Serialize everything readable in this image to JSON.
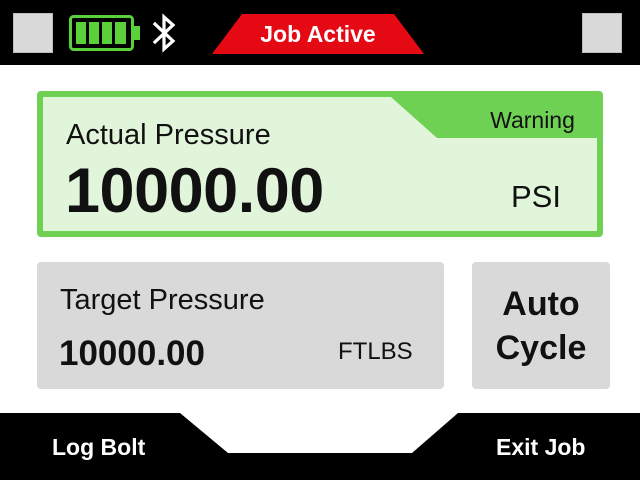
{
  "status_bar": {
    "job_status": "Job Active",
    "battery_icon": "battery-full-icon",
    "bluetooth_icon": "bluetooth-icon",
    "battery_level": 1.0,
    "colors": {
      "bar": "#000000",
      "job_tab": "#e50914",
      "battery": "#5ad13a"
    }
  },
  "actual_pressure": {
    "title": "Actual Pressure",
    "value": "10000.00",
    "unit": "PSI",
    "badge": "Warning",
    "colors": {
      "border": "#6fd154",
      "background": "#e1f5da"
    }
  },
  "target_pressure": {
    "title": "Target Pressure",
    "value": "10000.00",
    "unit": "FTLBS"
  },
  "auto_cycle": {
    "line1": "Auto",
    "line2": "Cycle"
  },
  "bottom_bar": {
    "left_label": "Log Bolt",
    "right_label": "Exit Job"
  }
}
